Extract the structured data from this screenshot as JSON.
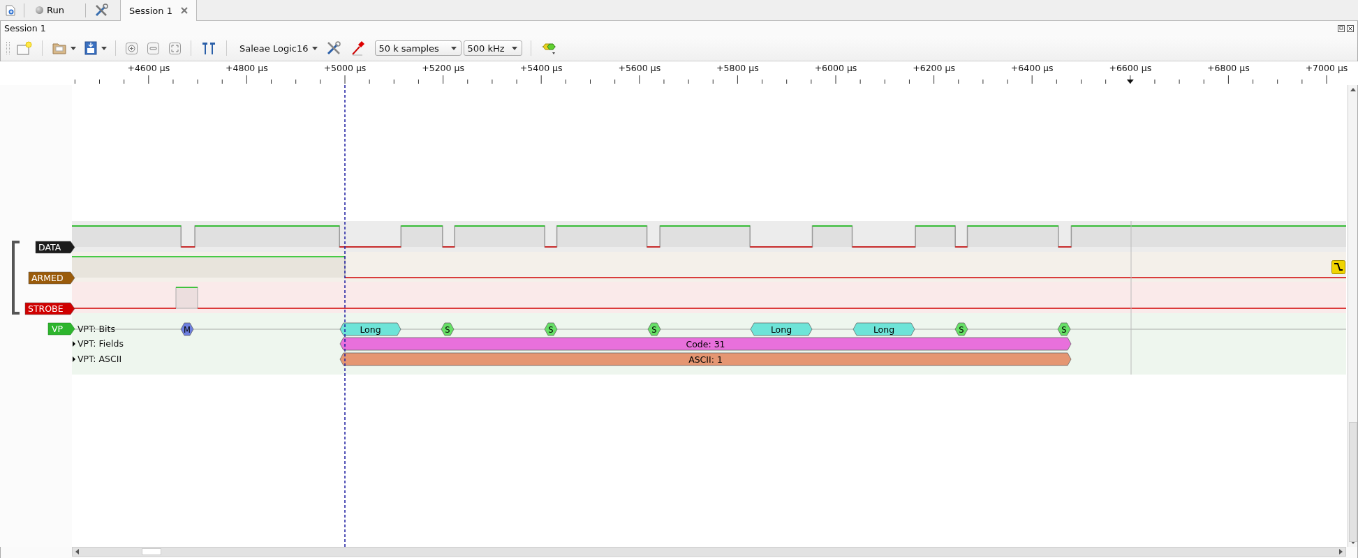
{
  "top_bar": {
    "run_button": "Run",
    "tabs": [
      {
        "label": "Session 1",
        "selected": true
      }
    ]
  },
  "session": {
    "title": "Session 1"
  },
  "toolbar": {
    "device": "Saleae Logic16",
    "samples": "50 k samples",
    "rate": "500 kHz"
  },
  "ruler": {
    "labels": [
      "+4600 µs",
      "+4800 µs",
      "+5000 µs",
      "+5200 µs",
      "+5400 µs",
      "+5600 µs",
      "+5800 µs",
      "+6000 µs",
      "+6200 µs",
      "+6400 µs",
      "+6600 µs",
      "+6800 µs",
      "+7000 µs"
    ]
  },
  "channels": [
    {
      "name": "DATA",
      "color": "#1c1c1c"
    },
    {
      "name": "ARMED",
      "color": "#9a5b0a"
    },
    {
      "name": "STROBE",
      "color": "#d00000"
    }
  ],
  "analyzer": {
    "name": "VP",
    "color": "#2db52d",
    "rows": [
      {
        "name": "VPT: Bits",
        "kind": "bits",
        "annotations": [
          {
            "text": "M",
            "color": "#6d7fe0"
          },
          {
            "text": "Long",
            "color": "#6ee4d8"
          },
          {
            "text": "S",
            "color": "#66e066"
          },
          {
            "text": "S",
            "color": "#66e066"
          },
          {
            "text": "S",
            "color": "#66e066"
          },
          {
            "text": "Long",
            "color": "#6ee4d8"
          },
          {
            "text": "Long",
            "color": "#6ee4d8"
          },
          {
            "text": "S",
            "color": "#66e066"
          },
          {
            "text": "S",
            "color": "#66e066"
          }
        ]
      },
      {
        "name": "VPT: Fields",
        "kind": "collapsed",
        "annotations": [
          {
            "text": "Code: 31",
            "color": "#e870dc"
          }
        ]
      },
      {
        "name": "VPT: ASCII",
        "kind": "collapsed",
        "annotations": [
          {
            "text": "ASCII: 1",
            "color": "#e59672"
          }
        ]
      }
    ]
  }
}
